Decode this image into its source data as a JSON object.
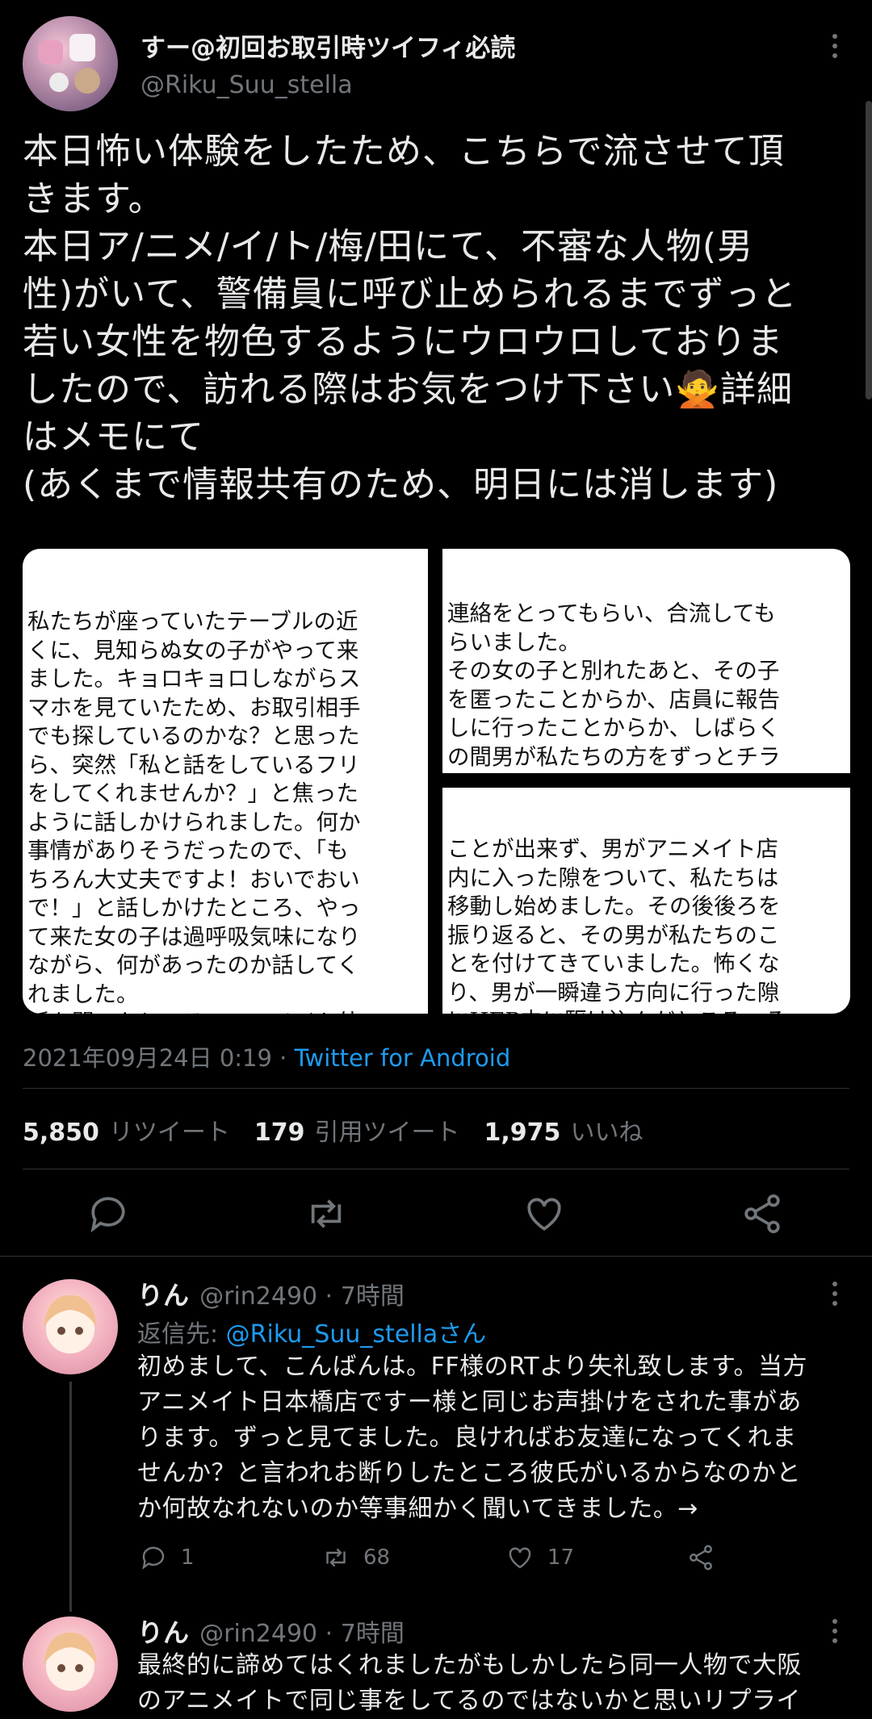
{
  "tweet": {
    "display_name": "すー@初回お取引時ツイフィ必読",
    "handle": "@Riku_Suu_stella",
    "text": "本日怖い体験をしたため、こちらで流させて頂\nきます。\n本日ア/ニメ/イ/ト/梅/田にて、不審な人物(男\n性)がいて、警備員に呼び止められるまでずっと\n若い女性を物色するようにウロウロしておりま\nしたので、訪れる際はお気をつけ下さい🙅詳細\nはメモにて\n(あくまで情報共有のため、明日には消します)",
    "memo_left": "私たちが座っていたテーブルの近\nくに、見知らぬ女の子がやって来\nました。キョロキョロしながらス\nマホを見ていたため、お取引相手\nでも探しているのかな？と思った\nら、突然「私と話をしているフリ\nをしてくれませんか？」と焦った\nように話しかけられました。何か\n事情がありそうだったので、「も\nちろん大丈夫ですよ！おいでおい\nで！」と話しかけたところ、やっ\nて来た女の子は過呼吸気味になり\nながら、何があったのか話してく\nれました。\n話を聞いたところ、アニメイト外\n側の壁(？)の写真を撮っていたら突",
    "memo_right_top": "連絡をとってもらい、合流しても\nらいました。\nその女の子と別れたあと、その子\nを匿ったことからか、店員に報告\nしに行ったことからか、しばらく\nの間男が私たちの方をずっとチラ\nチラ見ながらウロチョロしていま\nした。数分後、やはり更に怪しい",
    "memo_right_bottom": "ことが出来ず、男がアニメイト店\n内に入った隙をついて、私たちは\n移動し始めました。その後後ろを\n振り返ると、その男が私たちのこ\nとを付けてきていました。怖くな\nり、男が一瞬違う方向に行った隙\nにHEP内に駆け込んだところ、そ\nの男をまくことが出来ました。\nこのような不審な人物が、アニメ",
    "timestamp": "2021年09月24日 0:19",
    "separator": " · ",
    "client": "Twitter for Android",
    "retweets_count": "5,850",
    "retweets_label": "リツイート",
    "quotes_count": "179",
    "quotes_label": "引用ツイート",
    "likes_count": "1,975",
    "likes_label": "いいね"
  },
  "replies": [
    {
      "name": "りん",
      "handle_time": "@rin2490 · 7時間",
      "reply_to_prefix": "返信先: ",
      "reply_to_user": "@Riku_Suu_stellaさん",
      "text": "初めまして、こんばんは。FF様のRTより失礼致します。当方\nアニメイト日本橋店ですー様と同じお声掛けをされた事があ\nります。ずっと見てました。良ければお友達になってくれま\nせんか？と言われお断りしたところ彼氏がいるからなのかと\nか何故なれないのか等事細かく聞いてきました。→",
      "reply_count": "1",
      "retweet_count": "68",
      "like_count": "17"
    },
    {
      "name": "りん",
      "handle_time": "@rin2490 · 7時間",
      "text": "最終的に諦めてはくれましたがもしかしたら同一人物で大阪\nのアニメイトで同じ事をしてるのではないかと思いリプライ"
    }
  ],
  "icons": [
    "more-icon",
    "reply-icon",
    "retweet-icon",
    "like-icon",
    "share-icon"
  ],
  "colors": {
    "background": "#000000",
    "text": "#e7e9ea",
    "muted": "#71767b",
    "link": "#1d9bf0"
  }
}
